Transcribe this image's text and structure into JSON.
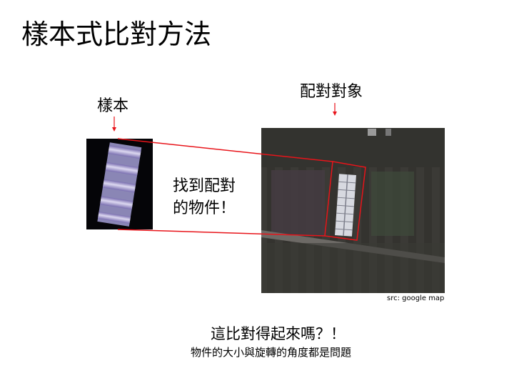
{
  "slide": {
    "title": "樣本式比對方法",
    "sample_label": "樣本",
    "target_label": "配對對象",
    "center_text": [
      "找到配對",
      "的物件！"
    ],
    "source": "src: google map",
    "question": "這比對得起來嗎？！",
    "note": "物件的大小與旋轉的角度都是問題"
  },
  "colors": {
    "connector": "#e8141a",
    "background": "#ffffff",
    "text": "#000000"
  }
}
